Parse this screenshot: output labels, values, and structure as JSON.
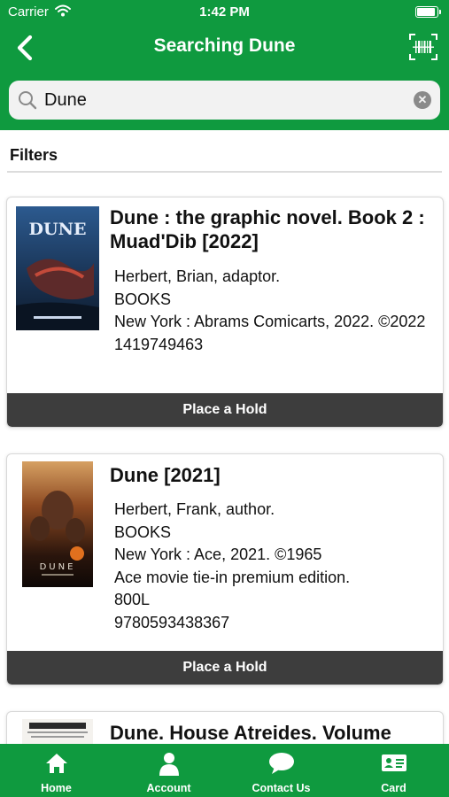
{
  "status_bar": {
    "carrier": "Carrier",
    "time": "1:42 PM"
  },
  "header": {
    "title": "Searching Dune",
    "back_icon": "chevron-left-icon",
    "scan_icon": "barcode-scan-icon"
  },
  "search": {
    "value": "Dune",
    "icon": "search-icon",
    "clear_icon": "clear-icon"
  },
  "filters": {
    "label": "Filters"
  },
  "results": [
    {
      "title": "Dune : the graphic novel. Book 2 : Muad'Dib [2022]",
      "author": "Herbert, Brian, adaptor.",
      "format": "BOOKS",
      "publisher": "New York : Abrams Comicarts, 2022. ©2022",
      "isbn": "1419749463",
      "hold_label": "Place a Hold"
    },
    {
      "title": "Dune [2021]",
      "author": "Herbert, Frank, author.",
      "format": "BOOKS",
      "publisher": "New York : Ace, 2021. ©1965",
      "edition": "Ace movie tie-in premium edition.",
      "lexile": "800L",
      "isbn": "9780593438367",
      "hold_label": "Place a Hold"
    },
    {
      "title": "Dune. House Atreides. Volume"
    }
  ],
  "tabs": [
    {
      "label": "Home",
      "icon": "home-icon"
    },
    {
      "label": "Account",
      "icon": "account-icon"
    },
    {
      "label": "Contact Us",
      "icon": "chat-bubble-icon"
    },
    {
      "label": "Card",
      "icon": "library-card-icon"
    }
  ],
  "colors": {
    "brand_green": "#0f9a3f",
    "hold_button": "#3d3d3d",
    "search_bg": "#f2f2f2"
  }
}
